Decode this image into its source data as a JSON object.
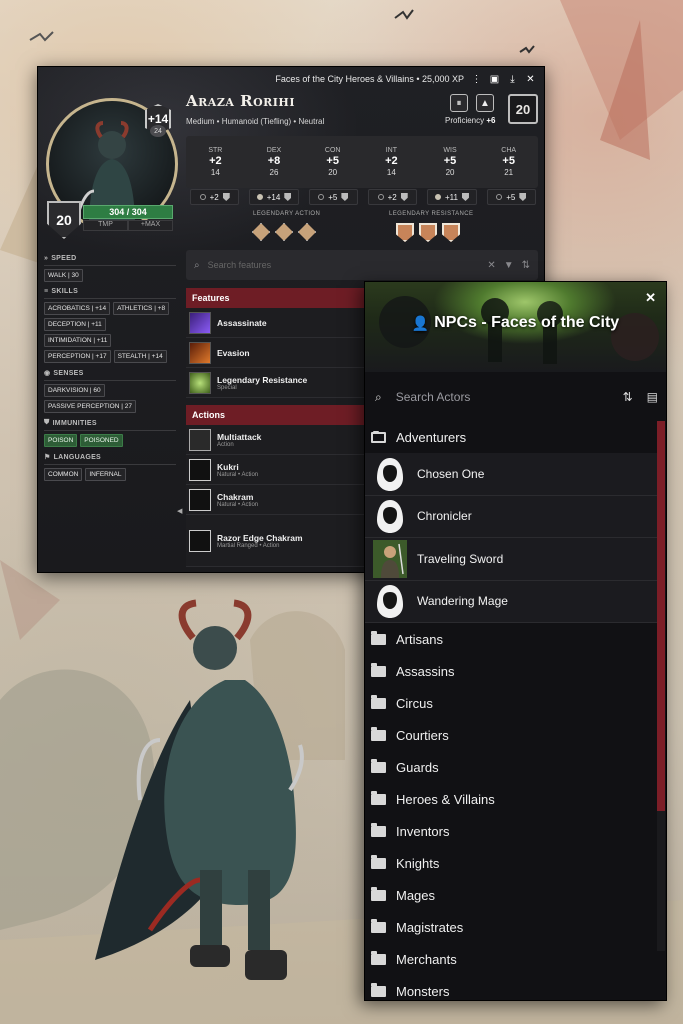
{
  "sheet": {
    "window_title": "Faces of the City Heroes & Villains • 25,000 XP",
    "titlebar_icons": [
      "book-icon",
      "menu-icon",
      "download-icon",
      "close-icon"
    ],
    "name": "Araza Rorihi",
    "meta": "Medium • Humanoid (Tiefling) • Neutral",
    "initiative": "+14",
    "initiative_score": "24",
    "armor_class": "20",
    "hp": "304 / 304",
    "hp_current": 304,
    "hp_max": 304,
    "tmp_label": "TMP",
    "max_label": "+MAX",
    "proficiency_label": "Proficiency",
    "proficiency_value": "+6",
    "level": "20",
    "abilities": [
      {
        "name": "STR",
        "mod": "+2",
        "score": "14"
      },
      {
        "name": "DEX",
        "mod": "+8",
        "score": "26"
      },
      {
        "name": "CON",
        "mod": "+5",
        "score": "20"
      },
      {
        "name": "INT",
        "mod": "+2",
        "score": "14"
      },
      {
        "name": "WIS",
        "mod": "+5",
        "score": "20"
      },
      {
        "name": "CHA",
        "mod": "+5",
        "score": "21"
      }
    ],
    "saves": [
      {
        "value": "+2",
        "proficient": false
      },
      {
        "value": "+14",
        "proficient": true
      },
      {
        "value": "+5",
        "proficient": false
      },
      {
        "value": "+2",
        "proficient": false
      },
      {
        "value": "+11",
        "proficient": true
      },
      {
        "value": "+5",
        "proficient": false
      }
    ],
    "legendary_action_label": "LEGENDARY ACTION",
    "legendary_resistance_label": "LEGENDARY RESISTANCE",
    "search_placeholder": "Search features",
    "side": {
      "speed_label": "SPEED",
      "speed": [
        "WALK | 30"
      ],
      "skills_label": "SKILLS",
      "skills": [
        "ACROBATICS | +14",
        "ATHLETICS | +8",
        "DECEPTION | +11",
        "INTIMIDATION | +11",
        "PERCEPTION | +17",
        "STEALTH | +14"
      ],
      "senses_label": "SENSES",
      "senses": [
        "DARKVISION | 60",
        "PASSIVE PERCEPTION | 27"
      ],
      "immunities_label": "IMMUNITIES",
      "immunities": [
        "POISON",
        "POISONED"
      ],
      "languages_label": "LANGUAGES",
      "languages": [
        "COMMON",
        "INFERNAL"
      ]
    },
    "features_label": "Features",
    "features": [
      {
        "name": "Assassinate",
        "sub": "",
        "icon": "assassinate-icon",
        "color": "#6a3fb3"
      },
      {
        "name": "Evasion",
        "sub": "",
        "icon": "evasion-icon",
        "color": "#b2541c"
      },
      {
        "name": "Legendary Resistance",
        "sub": "Special",
        "icon": "legendary-resistance-icon",
        "color": "#5f8a2c"
      }
    ],
    "actions_label": "Actions",
    "actions": [
      {
        "name": "Multiattack",
        "sub": "Action",
        "icon": "multiattack-icon"
      },
      {
        "name": "Kukri",
        "sub": "Natural • Action",
        "icon": "kukri-icon"
      },
      {
        "name": "Chakram",
        "sub": "Natural • Action",
        "icon": "chakram-icon"
      },
      {
        "name": "Razor Edge Chakram",
        "sub": "Martial Ranged • Action",
        "icon": "razor-edge-chakram-icon"
      }
    ]
  },
  "npc": {
    "title": "NPCs - Faces of the City",
    "search_placeholder": "Search Actors",
    "open_folder": "Adventurers",
    "actors": [
      "Chosen One",
      "Chronicler",
      "Traveling Sword",
      "Wandering Mage"
    ],
    "folders": [
      "Artisans",
      "Assassins",
      "Circus",
      "Courtiers",
      "Guards",
      "Heroes & Villains",
      "Inventors",
      "Knights",
      "Mages",
      "Magistrates",
      "Merchants",
      "Monsters"
    ]
  },
  "colors": {
    "accent_red": "#6e1d25",
    "hp_green": "#2e7d43",
    "scroll_thumb": "#7c1e27"
  }
}
